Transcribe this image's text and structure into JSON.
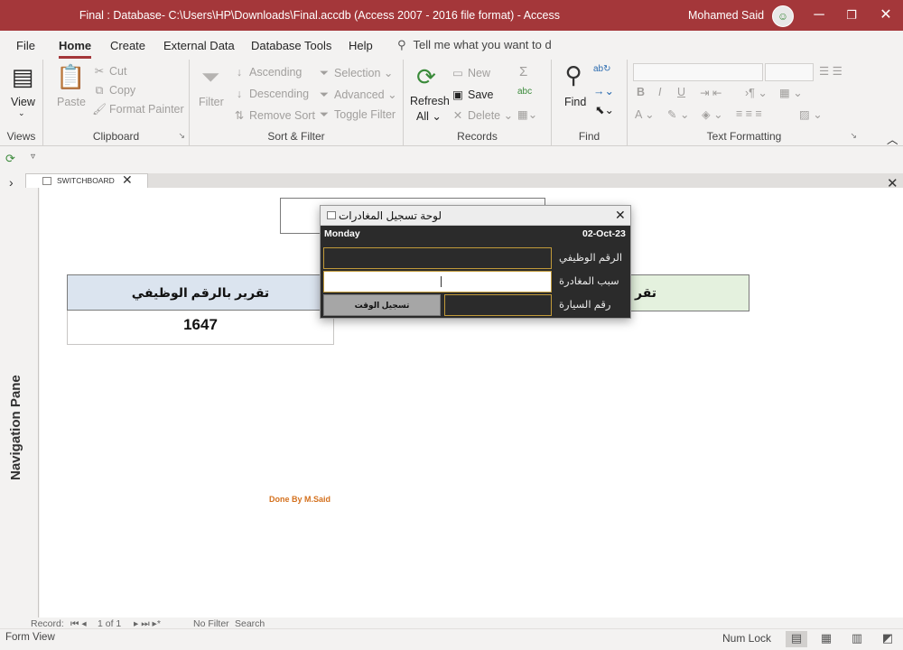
{
  "titlebar": {
    "title": "Final : Database- C:\\Users\\HP\\Downloads\\Final.accdb (Access 2007 - 2016 file format)  -  Access",
    "user": "Mohamed Said",
    "minimize": "─",
    "restore": "❐",
    "close": "✕"
  },
  "tabs": {
    "file": "File",
    "home": "Home",
    "create": "Create",
    "external": "External Data",
    "dbtools": "Database Tools",
    "help": "Help",
    "tellme": "Tell me what you want to d"
  },
  "ribbon": {
    "views": {
      "view": "View",
      "label": "Views"
    },
    "clipboard": {
      "paste": "Paste",
      "cut": "Cut",
      "copy": "Copy",
      "format_painter": "Format Painter",
      "label": "Clipboard"
    },
    "sortfilter": {
      "filter": "Filter",
      "ascending": "Ascending",
      "descending": "Descending",
      "remove_sort": "Remove Sort",
      "selection": "Selection",
      "advanced": "Advanced",
      "toggle_filter": "Toggle Filter",
      "label": "Sort & Filter"
    },
    "records": {
      "refresh": "Refresh",
      "refresh_all": "All",
      "new": "New",
      "save": "Save",
      "delete": "Delete",
      "label": "Records"
    },
    "find": {
      "find": "Find",
      "label": "Find"
    },
    "textformat": {
      "bold": "B",
      "italic": "I",
      "underline": "U",
      "label": "Text Formatting"
    }
  },
  "doc": {
    "tab_label": "SWITCHBOARD",
    "report_left_header": "تقرير بالرقم الوظيفي",
    "report_left_value": "1647",
    "report_right_header": "تقر",
    "done_by": "Done By M.Said"
  },
  "popup": {
    "title": "لوحة تسجيل المغادرات",
    "day": "Monday",
    "date": "02-Oct-23",
    "label_employee_id": "الرقم الوظيفي",
    "label_reason": "سبب المغادرة",
    "label_car": "رقم السيارة",
    "button_record_time": "تسجيل الوقت"
  },
  "navpane": {
    "label": "Navigation Pane"
  },
  "recnav": {
    "record_label": "Record:",
    "position": "1 of 1",
    "no_filter": "No Filter",
    "search": "Search"
  },
  "status": {
    "view": "Form View",
    "numlock": "Num Lock"
  }
}
